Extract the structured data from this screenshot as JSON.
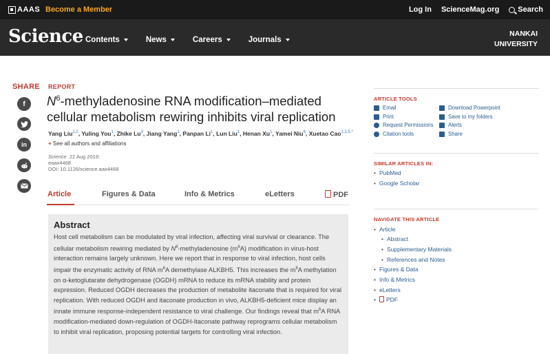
{
  "topbar": {
    "brand": "AAAS",
    "become_member": "Become a Member",
    "login": "Log In",
    "site": "ScienceMag.org",
    "search": "Search"
  },
  "nav": {
    "logo": "Science",
    "menu": [
      "Contents",
      "News",
      "Careers",
      "Journals"
    ],
    "institution_line1": "NANKAI",
    "institution_line2": "UNIVERSITY"
  },
  "share": {
    "label": "SHARE",
    "icons": [
      "facebook-icon",
      "twitter-icon",
      "linkedin-icon",
      "reddit-icon",
      "email-icon"
    ]
  },
  "article": {
    "type": "REPORT",
    "title_n": "N",
    "title_sup": "6",
    "title_rest_line1": "-methyladenosine RNA modification–mediated",
    "title_line2": "cellular metabolism rewiring inhibits viral replication",
    "authors": [
      {
        "name": "Yang Liu",
        "sup": "1,2"
      },
      {
        "name": "Yuling You",
        "sup": "1"
      },
      {
        "name": "Zhike Lu",
        "sup": "3"
      },
      {
        "name": "Jiang Yang",
        "sup": "1"
      },
      {
        "name": "Panpan Li",
        "sup": "1"
      },
      {
        "name": "Lun Liu",
        "sup": "1"
      },
      {
        "name": "Henan Xu",
        "sup": "1"
      },
      {
        "name": "Yamei Niu",
        "sup": "4"
      },
      {
        "name": "Xuetao Cao",
        "sup": "1,2,5,*"
      }
    ],
    "see_all": "See all authors and affiliations",
    "journal": "Science",
    "date": "22 Aug 2019:",
    "article_id": "eaax4468",
    "doi": "DOI: 10.1126/science.aax4468"
  },
  "tabs": {
    "article": "Article",
    "figures": "Figures & Data",
    "info": "Info & Metrics",
    "eletters": "eLetters",
    "pdf": "PDF"
  },
  "abstract": {
    "heading": "Abstract",
    "p1": "Host cell metabolism can be modulated by viral infection, affecting viral survival or clearance. The cellular metabolism rewiring mediated by ",
    "p1_n": "N",
    "p1_sup": "6",
    "p1_b": "-methyladenosine (m",
    "p1_sup2": "6",
    "p1_c": "A) modification in virus-host interaction remains largely unknown. Here we report that in response to viral infection, host cells impair the enzymatic activity of RNA m",
    "p1_sup3": "6",
    "p1_d": "A demethylase ALKBH5. This increases the m",
    "p1_sup4": "6",
    "p1_e": "A methylation on α-ketoglutarate dehydrogenase (OGDH) mRNA to reduce its mRNA stability and protein expression. Reduced OGDH decreases the production of metabolite itaconate that is required for viral replication. With reduced OGDH and itaconate production in vivo, ALKBH5-deficient mice display an innate immune response-independent resistance to viral challenge. Our findings reveal that m",
    "p1_sup5": "6",
    "p1_f": "A RNA modification-mediated down-regulation of OGDH-Itaconate pathway reprograms cellular metabolism to inhibit viral replication, proposing potential targets for controlling viral infection."
  },
  "sidebar": {
    "tools_heading": "ARTICLE TOOLS",
    "tools_left": [
      "Email",
      "Print",
      "Request Permissions",
      "Citation tools"
    ],
    "tools_right": [
      "Download Powerpoint",
      "Save to my folders",
      "Alerts",
      "Share"
    ],
    "similar_heading": "SIMILAR ARTICLES IN:",
    "similar": [
      "PubMed",
      "Google Scholar"
    ],
    "navigate_heading": "NAVIGATE THIS ARTICLE",
    "navigate": [
      {
        "label": "Article",
        "indent": false
      },
      {
        "label": "Abstract",
        "indent": true
      },
      {
        "label": "Supplementary Materials",
        "indent": true
      },
      {
        "label": "References and Notes",
        "indent": true
      },
      {
        "label": "Figures & Data",
        "indent": false
      },
      {
        "label": "Info & Metrics",
        "indent": false
      },
      {
        "label": "eLetters",
        "indent": false
      },
      {
        "label": "PDF",
        "indent": false
      }
    ]
  },
  "colors": {
    "accent_red": "#c0392b",
    "link_blue": "#2a5d8f",
    "member_orange": "#f5a623"
  }
}
